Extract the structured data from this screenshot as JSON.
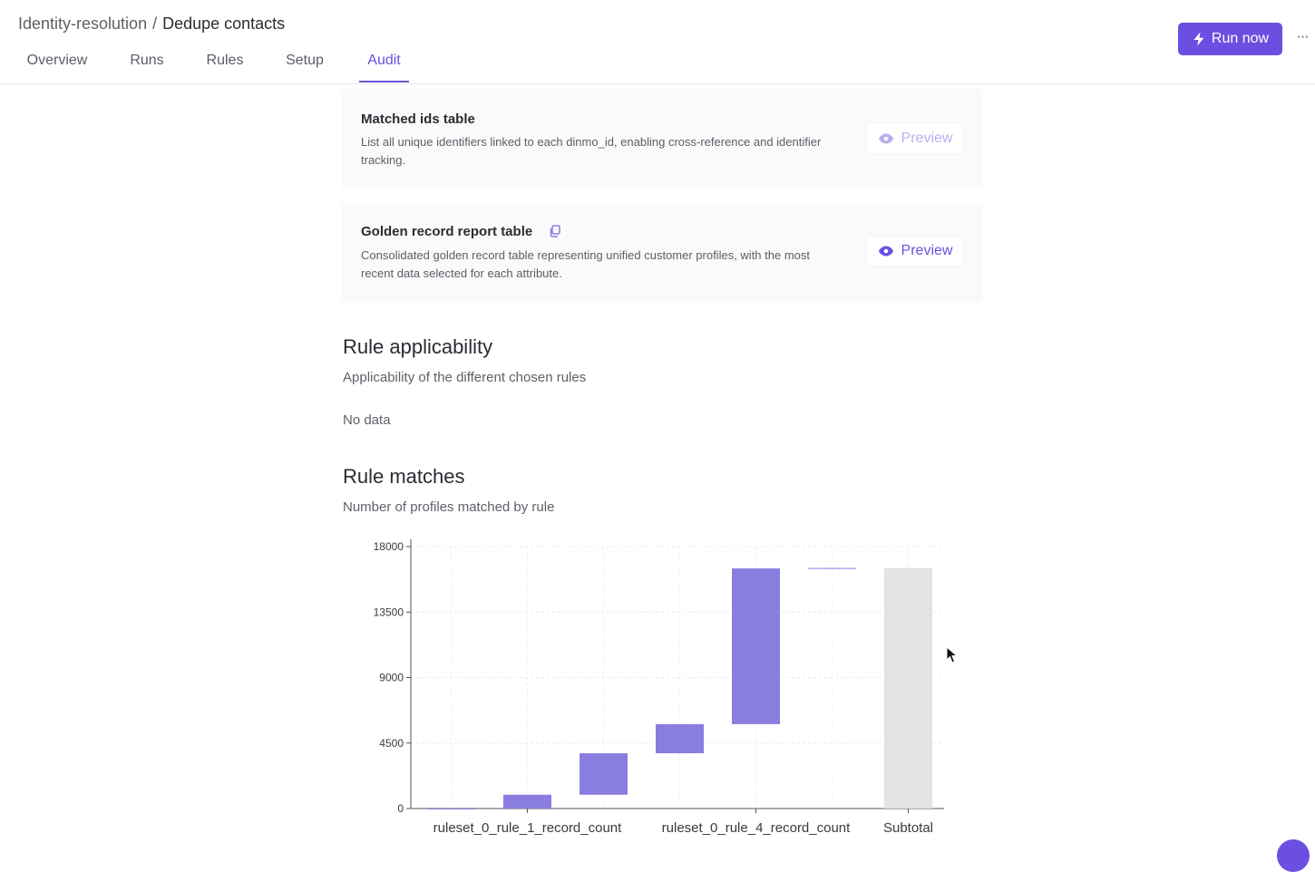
{
  "header": {
    "breadcrumb_parent": "Identity-resolution",
    "breadcrumb_separator": "/",
    "breadcrumb_current": "Dedupe contacts",
    "run_label": "Run now",
    "more_label": "···",
    "tabs": [
      {
        "label": "Overview",
        "active": false
      },
      {
        "label": "Runs",
        "active": false
      },
      {
        "label": "Rules",
        "active": false
      },
      {
        "label": "Setup",
        "active": false
      },
      {
        "label": "Audit",
        "active": true
      }
    ]
  },
  "tables": [
    {
      "title": "Matched ids table",
      "description": "List all unique identifiers linked to each dinmo_id, enabling cross-reference and identifier tracking.",
      "preview_label": "Preview",
      "preview_enabled": false
    },
    {
      "title": "Golden record report table",
      "description": "Consolidated golden record table representing unified customer profiles, with the most recent data selected for each attribute.",
      "preview_label": "Preview",
      "preview_enabled": true
    }
  ],
  "rule_applicability": {
    "title": "Rule applicability",
    "subtitle": "Applicability of the different chosen rules",
    "empty_text": "No data"
  },
  "rule_matches": {
    "title": "Rule matches",
    "subtitle": "Number of profiles matched by rule"
  },
  "colors": {
    "accent": "#6b4fe0",
    "bar": "#8a7de0",
    "subtotal": "#e3e3e6"
  },
  "chart_data": {
    "type": "bar",
    "subtype": "waterfall",
    "categories": [
      "",
      "ruleset_0_rule_1_record_count",
      "",
      "",
      "ruleset_0_rule_4_record_count",
      "",
      "Subtotal"
    ],
    "x_tick_labels": [
      "ruleset_0_rule_1_record_count",
      "ruleset_0_rule_4_record_count",
      "Subtotal"
    ],
    "bars": [
      {
        "start": 0,
        "end": 0
      },
      {
        "start": 0,
        "end": 950
      },
      {
        "start": 950,
        "end": 3800
      },
      {
        "start": 3800,
        "end": 5800
      },
      {
        "start": 5800,
        "end": 16500
      },
      {
        "start": 16500,
        "end": 16530
      },
      {
        "start": 0,
        "end": 16530,
        "subtotal": true
      }
    ],
    "y_ticks": [
      0,
      4500,
      9000,
      13500,
      18000
    ],
    "ylim": [
      0,
      18000
    ],
    "grid": true
  }
}
